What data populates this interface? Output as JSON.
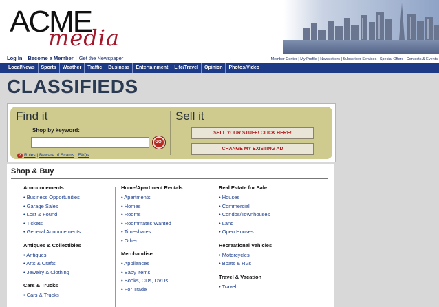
{
  "header": {
    "logo_top": "ACME",
    "logo_bottom": "media"
  },
  "utility": {
    "login": "Log In",
    "member": "Become a Member",
    "newspaper": "Get the Newspaper",
    "right_links": "Member Center | My Profile | Newsletters | Subscriber Services | Special Offers | Contests & Events"
  },
  "nav": {
    "items": [
      "Local/News",
      "Sports",
      "Weather",
      "Traffic",
      "Business",
      "Entertainment",
      "Life/Travel",
      "Opinion",
      "Photos/Video"
    ]
  },
  "page_title": "CLASSIFIEDS",
  "find": {
    "title": "Find it",
    "keyword_label": "Shop by keyword:",
    "keyword_value": "",
    "go_label": "GO!",
    "rules": "Rules",
    "scams": "Beware of Scams",
    "faqs": "FAQs"
  },
  "sell": {
    "title": "Sell it",
    "sell_button": "SELL YOUR STUFF! CLICK HERE!",
    "change_button": "CHANGE MY EXISTING AD"
  },
  "shop": {
    "title": "Shop & Buy",
    "col1": [
      {
        "heading": "Announcements",
        "items": [
          "Business Opportunities",
          "Garage Sales",
          "Lost & Found",
          "Tickets",
          "General Annoucements"
        ]
      },
      {
        "heading": "Antiques & Collectibles",
        "items": [
          "Antiques",
          "Arts & Crafts",
          "Jewelry & Clothing"
        ]
      },
      {
        "heading": "Cars & Trucks",
        "items": [
          "Cars & Trucks"
        ]
      }
    ],
    "col2": [
      {
        "heading": "Home/Apartment Rentals",
        "items": [
          "Apartments",
          "Homes",
          "Rooms",
          "Roommates Wanted",
          "Timeshares",
          "Other"
        ]
      },
      {
        "heading": "Merchandise",
        "items": [
          "Appliances",
          "Baby Items",
          "Books, CDs, DVDs",
          "For Trade"
        ]
      }
    ],
    "col3": [
      {
        "heading": "Real Estate for Sale",
        "items": [
          "Houses",
          "Commercial",
          "Condos/Townhouses",
          "Land",
          "Open Houses"
        ]
      },
      {
        "heading": "Recreational Vehicles",
        "items": [
          "Motorcycles",
          "Boats & RVs"
        ]
      },
      {
        "heading": "Travel & Vacation",
        "items": [
          "Travel"
        ]
      }
    ]
  },
  "colors": {
    "nav_bg": "#1d3a86",
    "link": "#1c3e8c",
    "find_bg": "#cfcb8f",
    "accent_red": "#b1191b"
  }
}
